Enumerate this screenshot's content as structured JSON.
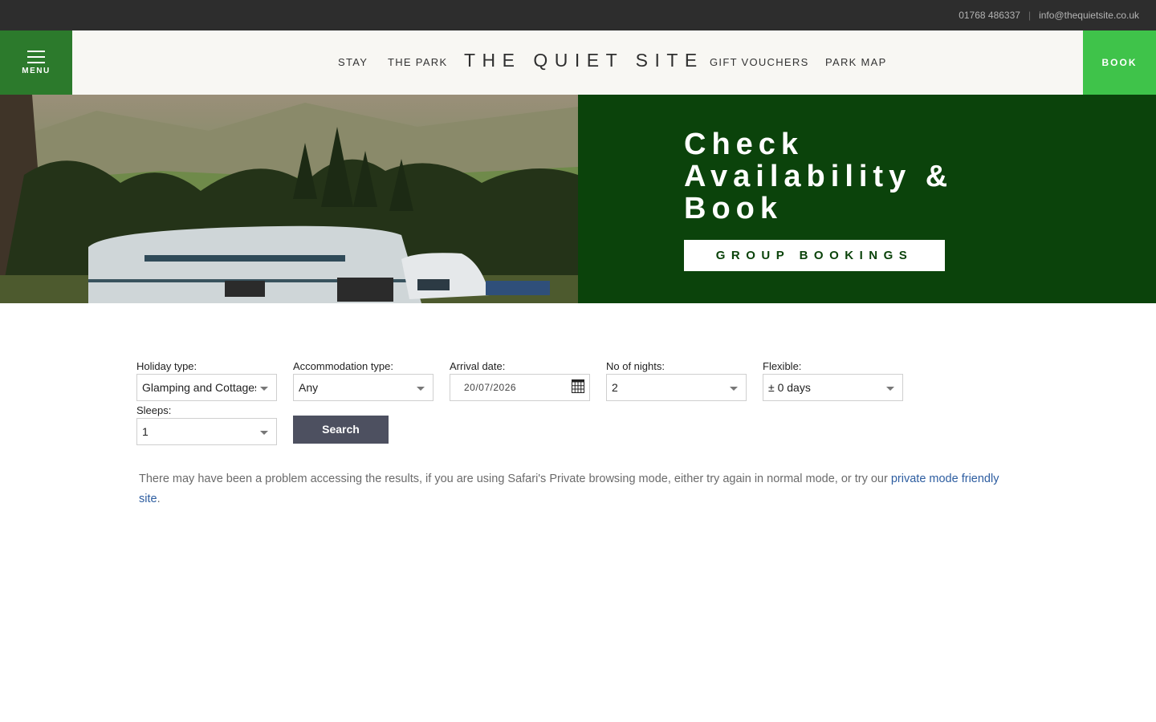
{
  "topbar": {
    "phone": "01768 486337",
    "separator": "|",
    "email": "info@thequietsite.co.uk"
  },
  "header": {
    "menu_label": "MENU",
    "nav_left": [
      "STAY",
      "THE PARK"
    ],
    "logo": "THE QUIET SITE",
    "nav_right": [
      "GIFT VOUCHERS",
      "PARK MAP"
    ],
    "book_label": "BOOK"
  },
  "hero": {
    "title_line1": "Check",
    "title_line2": "Availability &",
    "title_line3": "Book",
    "group_button": "GROUP BOOKINGS"
  },
  "search_form": {
    "holiday_type": {
      "label": "Holiday type:",
      "value": "Glamping and Cottages"
    },
    "accommodation_type": {
      "label": "Accommodation type:",
      "value": "Any"
    },
    "arrival_date": {
      "label": "Arrival date:",
      "value": "20/07/2026"
    },
    "nights": {
      "label": "No of nights:",
      "value": "2"
    },
    "flexible": {
      "label": "Flexible:",
      "value": "± 0 days"
    },
    "sleeps": {
      "label": "Sleeps:",
      "value": "1"
    },
    "search_button": "Search"
  },
  "notice": {
    "text": "There may have been a problem accessing the results, if you are using Safari's Private browsing mode, either try again in normal mode, or try our ",
    "link_text": "private mode friendly site",
    "end": "."
  },
  "colors": {
    "brand_dark_green": "#0b430b",
    "menu_green": "#2c7a2c",
    "book_green": "#3fc34a",
    "button_slate": "#4d5060",
    "link_blue": "#2d5da0"
  }
}
